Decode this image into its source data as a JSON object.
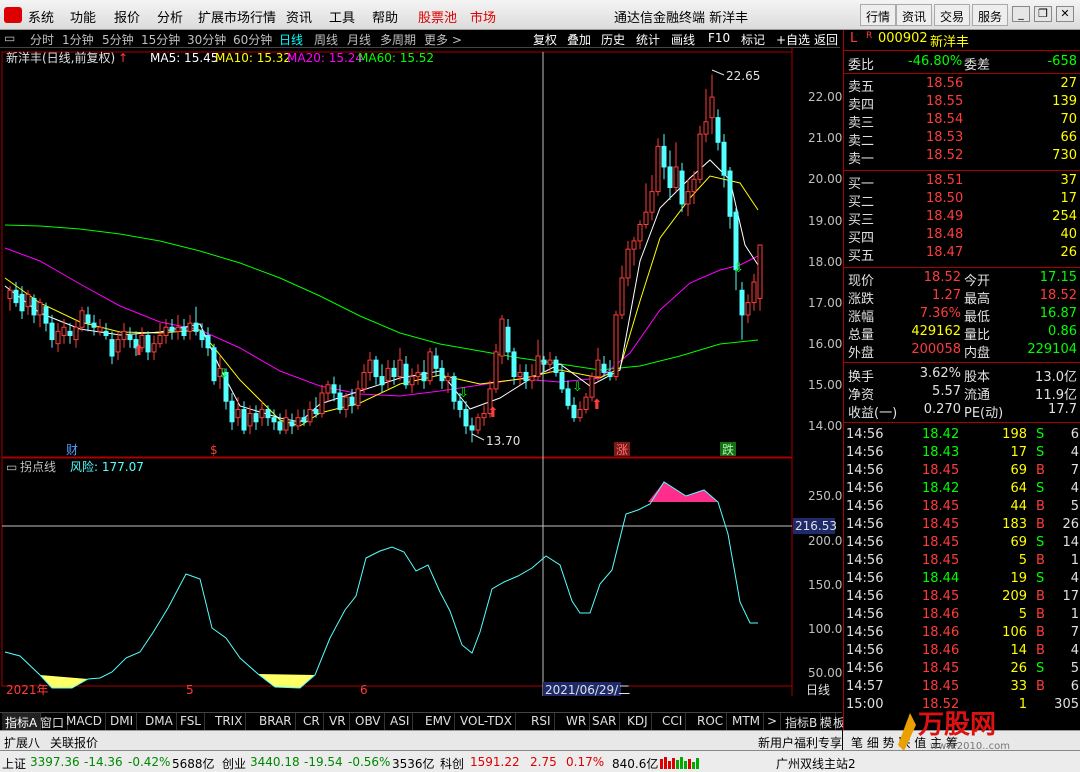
{
  "menubar": {
    "menus": [
      "系统",
      "功能",
      "报价",
      "分析",
      "扩展市场行情",
      "资讯",
      "工具",
      "帮助",
      "股票池",
      "市场"
    ],
    "title": "通达信金融终端 新洋丰",
    "right_buttons": [
      "行情",
      "资讯",
      "交易",
      "服务"
    ]
  },
  "toolbar": {
    "periods": [
      "分时",
      "1分钟",
      "5分钟",
      "15分钟",
      "30分钟",
      "60分钟",
      "日线",
      "周线",
      "月线",
      "多周期",
      "更多 >"
    ],
    "active_period": "日线",
    "buttons": [
      "复权",
      "叠加",
      "历史",
      "统计",
      "画线",
      "F10",
      "标记",
      "+自选",
      "返回"
    ]
  },
  "main_chart": {
    "header_name": "新洋丰(日线,前复权)",
    "ma_labels": [
      {
        "text": "MA5: 15.45",
        "color": "#ffffff"
      },
      {
        "text": "MA10: 15.32",
        "color": "#ffff00"
      },
      {
        "text": "MA20: 15.24",
        "color": "#ff00ff"
      },
      {
        "text": "MA60: 15.52",
        "color": "#00ff00"
      }
    ],
    "y_ticks": [
      "22.00",
      "21.00",
      "20.00",
      "19.00",
      "18.00",
      "17.00",
      "16.00",
      "15.00",
      "14.00"
    ],
    "high_label": "22.65",
    "low_label": "13.70",
    "markers": [
      "财",
      "$",
      "涨",
      "跌"
    ]
  },
  "indicator": {
    "name": "拐点线",
    "value_label": "风险: 177.07",
    "y_ticks": [
      "250.0",
      "200.0",
      "150.0",
      "100.0",
      "50.00"
    ],
    "cursor_value": "216.53"
  },
  "x_axis": {
    "labels": [
      "2021年",
      "5",
      "6"
    ],
    "cursor_date": "2021/06/29/二",
    "period_label": "日线"
  },
  "bottom_tabs": [
    "指标A",
    "窗口",
    "MACD",
    "DMI",
    "DMA",
    "FSL",
    "TRIX",
    "BRAR",
    "CR",
    "VR",
    "OBV",
    "ASI",
    "EMV",
    "VOL-TDX",
    "RSI",
    "WR",
    "SAR",
    "KDJ",
    "CCI",
    "ROC",
    "MTM",
    ">",
    "指标B",
    "模",
    "板"
  ],
  "bottom_tabs2": {
    "left": "扩展八",
    "mid": "关联报价",
    "right": "新用户福利专享"
  },
  "panel": {
    "code": "000902",
    "name": "新洋丰",
    "weibi_label": "委比",
    "weibi": "-46.80%",
    "weicha_label": "委差",
    "weicha": "-658",
    "asks": [
      {
        "label": "卖五",
        "price": "18.56",
        "vol": "27"
      },
      {
        "label": "卖四",
        "price": "18.55",
        "vol": "139"
      },
      {
        "label": "卖三",
        "price": "18.54",
        "vol": "70"
      },
      {
        "label": "卖二",
        "price": "18.53",
        "vol": "66"
      },
      {
        "label": "卖一",
        "price": "18.52",
        "vol": "730"
      }
    ],
    "bids": [
      {
        "label": "买一",
        "price": "18.51",
        "vol": "37"
      },
      {
        "label": "买二",
        "price": "18.50",
        "vol": "17"
      },
      {
        "label": "买三",
        "price": "18.49",
        "vol": "254"
      },
      {
        "label": "买四",
        "price": "18.48",
        "vol": "40"
      },
      {
        "label": "买五",
        "price": "18.47",
        "vol": "26"
      }
    ],
    "stats": [
      {
        "l1": "现价",
        "v1": "18.52",
        "c1": "red",
        "l2": "今开",
        "v2": "17.15",
        "c2": "green"
      },
      {
        "l1": "涨跌",
        "v1": "1.27",
        "c1": "red",
        "l2": "最高",
        "v2": "18.52",
        "c2": "red"
      },
      {
        "l1": "涨幅",
        "v1": "7.36%",
        "c1": "red",
        "l2": "最低",
        "v2": "16.87",
        "c2": "green"
      },
      {
        "l1": "总量",
        "v1": "429162",
        "c1": "yellow",
        "l2": "量比",
        "v2": "0.86",
        "c2": "green"
      },
      {
        "l1": "外盘",
        "v1": "200058",
        "c1": "red",
        "l2": "内盘",
        "v2": "229104",
        "c2": "green"
      }
    ],
    "stats2": [
      {
        "l1": "换手",
        "v1": "3.62%",
        "l2": "股本",
        "v2": "13.0亿"
      },
      {
        "l1": "净资",
        "v1": "5.57",
        "l2": "流通",
        "v2": "11.9亿"
      },
      {
        "l1": "收益(一)",
        "v1": "0.270",
        "l2": "PE(动)",
        "v2": "17.7"
      }
    ],
    "ticks": [
      {
        "t": "14:56",
        "p": "18.42",
        "v": "198",
        "s": "S",
        "n": "6"
      },
      {
        "t": "14:56",
        "p": "18.43",
        "v": "17",
        "s": "S",
        "n": "4"
      },
      {
        "t": "14:56",
        "p": "18.45",
        "v": "69",
        "s": "B",
        "n": "7"
      },
      {
        "t": "14:56",
        "p": "18.42",
        "v": "64",
        "s": "S",
        "n": "4"
      },
      {
        "t": "14:56",
        "p": "18.45",
        "v": "44",
        "s": "B",
        "n": "5"
      },
      {
        "t": "14:56",
        "p": "18.45",
        "v": "183",
        "s": "B",
        "n": "26"
      },
      {
        "t": "14:56",
        "p": "18.45",
        "v": "69",
        "s": "S",
        "n": "14"
      },
      {
        "t": "14:56",
        "p": "18.45",
        "v": "5",
        "s": "B",
        "n": "1"
      },
      {
        "t": "14:56",
        "p": "18.44",
        "v": "19",
        "s": "S",
        "n": "4"
      },
      {
        "t": "14:56",
        "p": "18.45",
        "v": "209",
        "s": "B",
        "n": "17"
      },
      {
        "t": "14:56",
        "p": "18.46",
        "v": "5",
        "s": "B",
        "n": "1"
      },
      {
        "t": "14:56",
        "p": "18.46",
        "v": "106",
        "s": "B",
        "n": "7"
      },
      {
        "t": "14:56",
        "p": "18.46",
        "v": "14",
        "s": "B",
        "n": "4"
      },
      {
        "t": "14:56",
        "p": "18.45",
        "v": "26",
        "s": "S",
        "n": "5"
      },
      {
        "t": "14:57",
        "p": "18.45",
        "v": "33",
        "s": "B",
        "n": "6"
      },
      {
        "t": "15:00",
        "p": "18.52",
        "v": "1",
        "s": "",
        "n": "305"
      }
    ],
    "footer": "笔 细 势 联 值 主 筹"
  },
  "status": {
    "sh_label": "上证",
    "sh_val": "3397.36",
    "sh_chg": "-14.36",
    "sh_pct": "-0.42%",
    "sh_amt": "5688亿",
    "cy_label": "创业",
    "cy_val": "3440.18",
    "cy_chg": "-19.54",
    "cy_pct": "-0.56%",
    "cy_amt": "3536亿",
    "kc_label": "科创",
    "kc_val": "1591.22",
    "kc_chg": "2.75",
    "kc_pct": "0.17%",
    "kc_amt": "840.6亿",
    "server": "广州双线主站2"
  },
  "watermark": {
    "text": "万股网",
    "url": "www.2010..com"
  },
  "colors": {
    "up": "#ff3c3c",
    "down": "#54ffff",
    "ma5": "#ffffff",
    "ma10": "#ffff00",
    "ma20": "#ff00ff",
    "ma60": "#00ff00",
    "indicator": "#54ffff"
  }
}
